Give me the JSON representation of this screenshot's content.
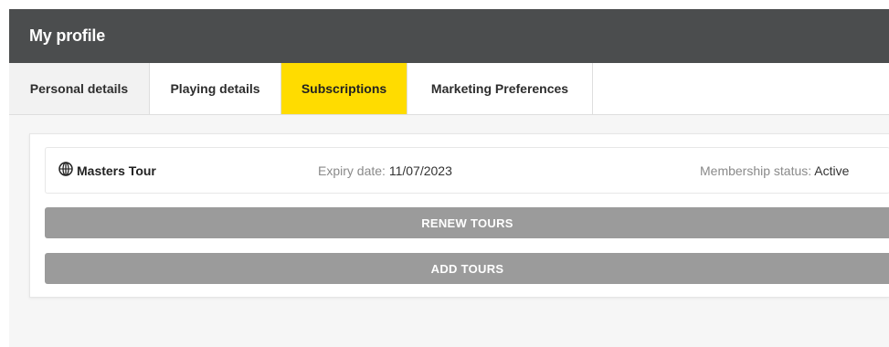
{
  "header": {
    "title": "My profile"
  },
  "tabs": [
    {
      "label": "Personal details",
      "active": false
    },
    {
      "label": "Playing details",
      "active": false
    },
    {
      "label": "Subscriptions",
      "active": true
    },
    {
      "label": "Marketing Preferences",
      "active": false
    }
  ],
  "subscription": {
    "tour_icon": "globe-icon",
    "tour_name": "Masters Tour",
    "expiry_label": "Expiry date:",
    "expiry_value": "11/07/2023",
    "status_label": "Membership status:",
    "status_value": "Active"
  },
  "buttons": {
    "renew_label": "RENEW TOURS",
    "add_label": "ADD TOURS"
  },
  "colors": {
    "header_bg": "#4b4d4e",
    "active_tab": "#ffdc00",
    "button_bg": "#9b9b9b"
  }
}
